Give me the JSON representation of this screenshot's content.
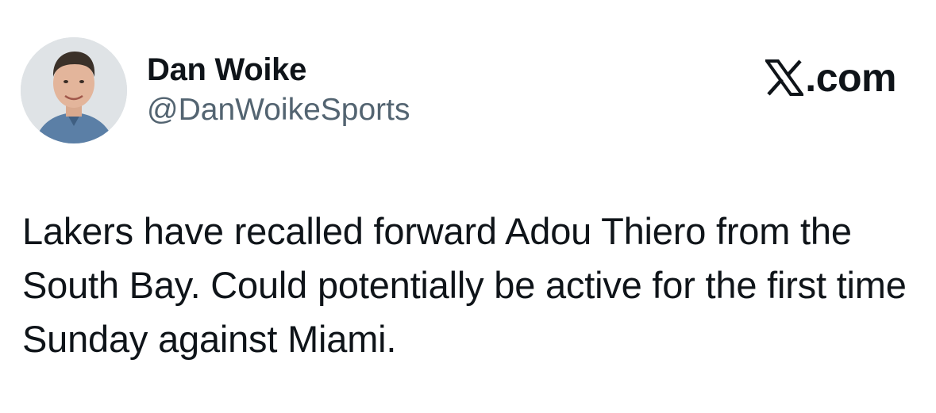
{
  "author": {
    "display_name": "Dan Woike",
    "handle": "@DanWoikeSports",
    "avatar_icon": "profile-photo"
  },
  "source": {
    "logo_icon": "x-logo-icon",
    "text": ".com"
  },
  "tweet": {
    "text": "Lakers have recalled forward Adou Thiero from the South Bay. Could potentially be active for the first time Sunday against Miami."
  },
  "colors": {
    "text_primary": "#0f1419",
    "text_secondary": "#536471",
    "background": "#ffffff"
  }
}
